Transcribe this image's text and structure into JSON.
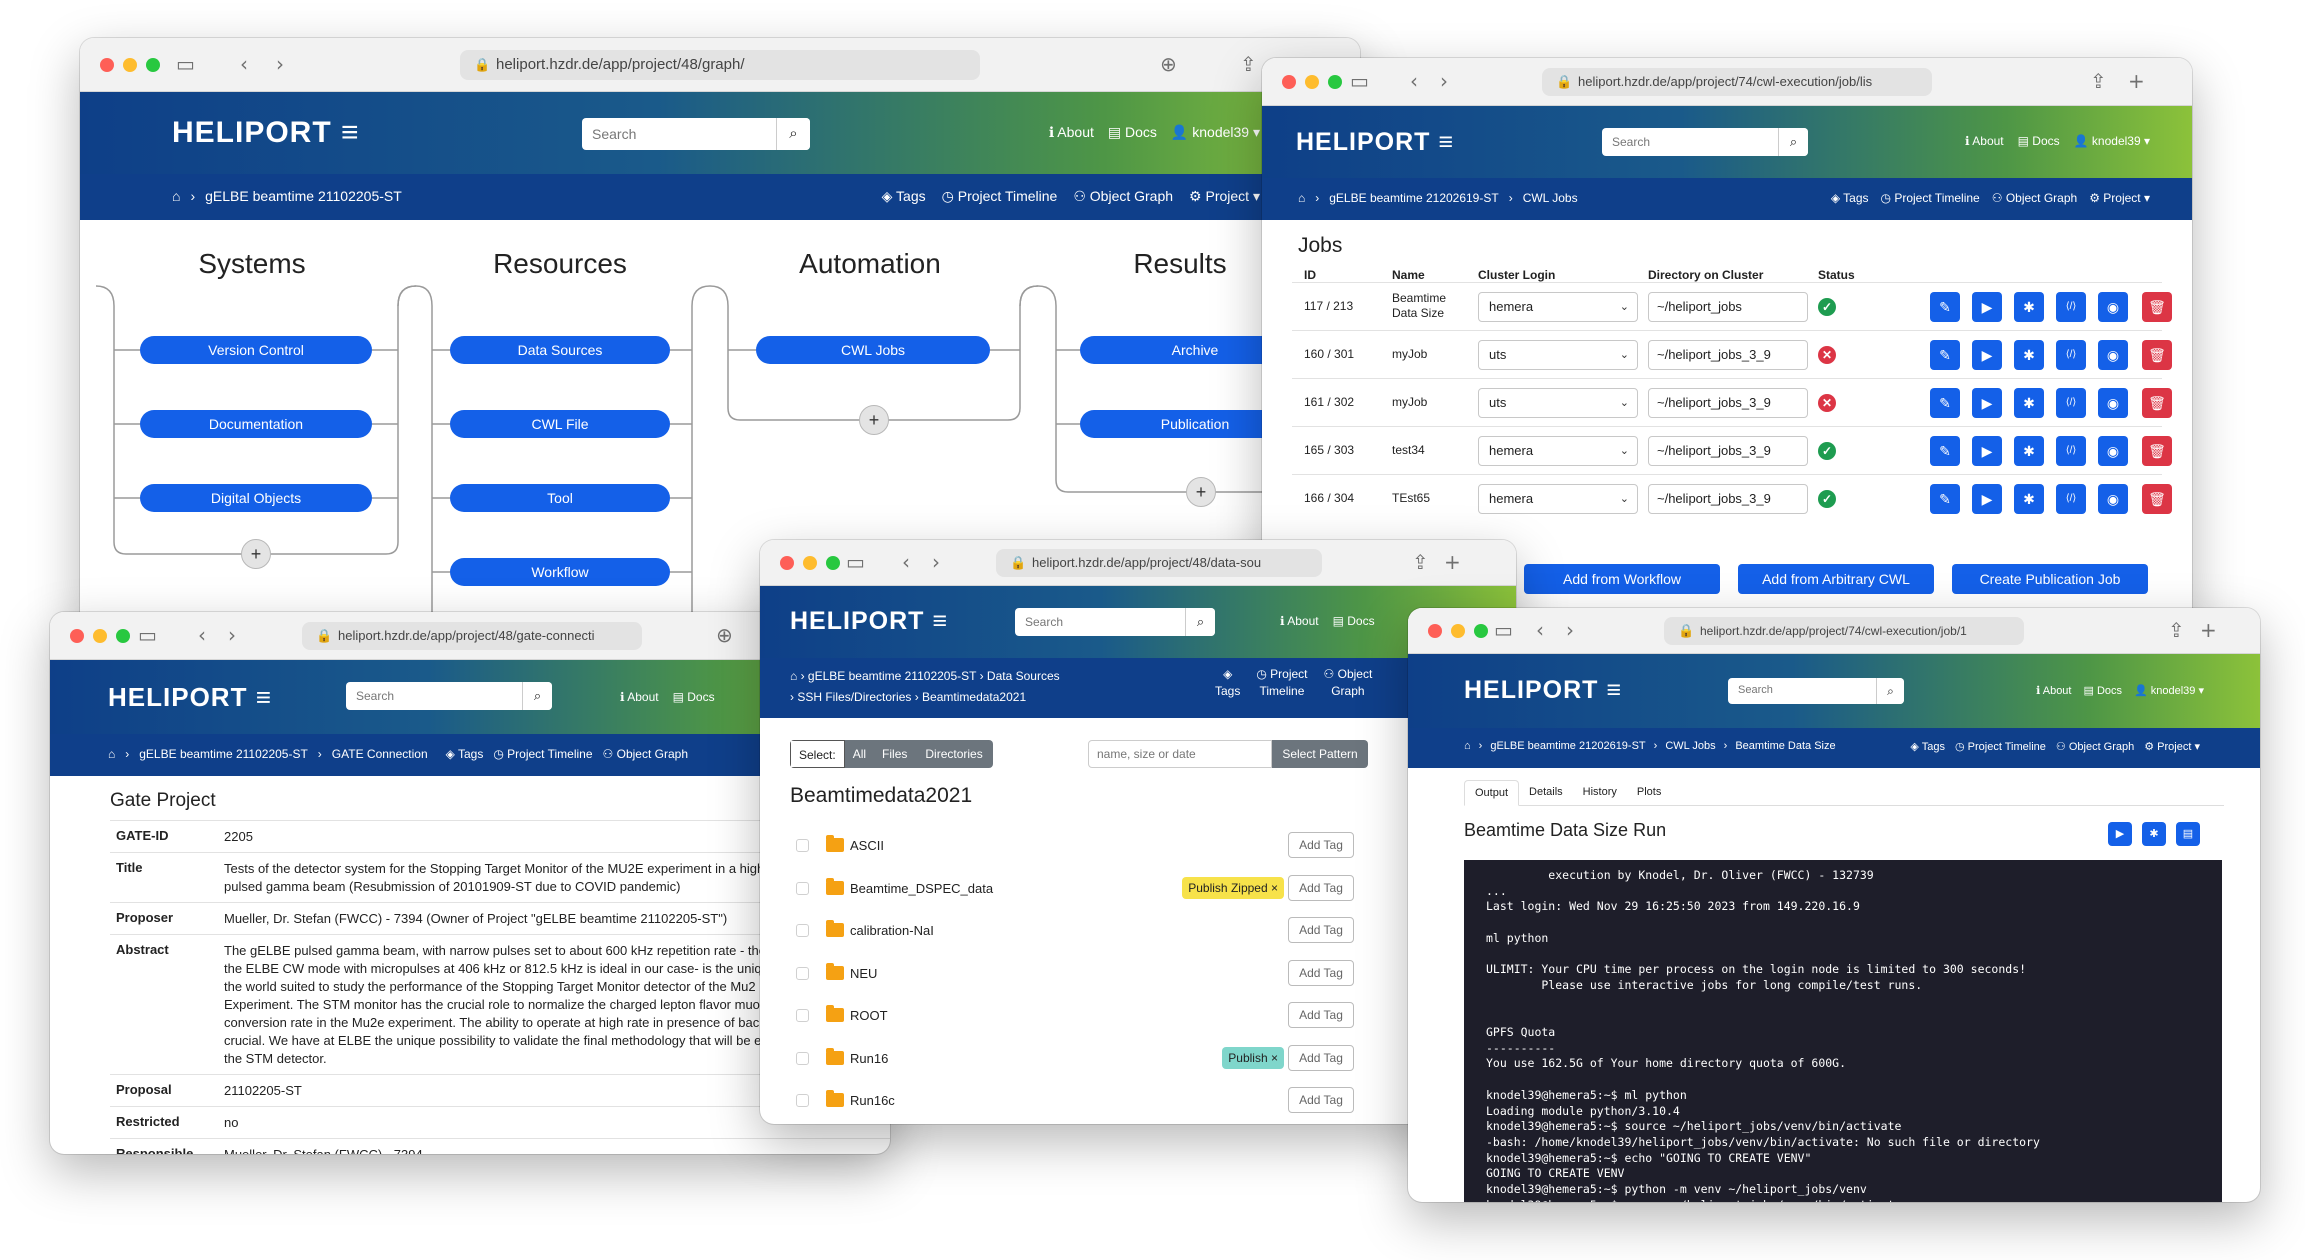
{
  "brand": {
    "logo_text": "HELIPORT"
  },
  "header": {
    "search_placeholder": "Search",
    "about": "About",
    "docs": "Docs",
    "user": "knodel39"
  },
  "graph_window": {
    "url": "heliport.hzdr.de/app/project/48/graph/",
    "breadcrumb": "gELBE beamtime 21102205-ST",
    "nav": [
      "Tags",
      "Project Timeline",
      "Object Graph",
      "Project"
    ],
    "columns": [
      {
        "title": "Systems",
        "items": [
          "Version Control",
          "Documentation",
          "Digital Objects"
        ]
      },
      {
        "title": "Resources",
        "items": [
          "Data Sources",
          "CWL File",
          "Tool",
          "Workflow"
        ]
      },
      {
        "title": "Automation",
        "items": [
          "CWL Jobs"
        ]
      },
      {
        "title": "Results",
        "items": [
          "Archive",
          "Publication"
        ]
      }
    ],
    "add_symbol": "+"
  },
  "jobs_window": {
    "url": "heliport.hzdr.de/app/project/74/cwl-execution/job/lis",
    "breadcrumb": [
      "gELBE beamtime 21202619-ST",
      "CWL Jobs"
    ],
    "nav": [
      "Tags",
      "Project Timeline",
      "Object Graph",
      "Project"
    ],
    "title": "Jobs",
    "columns": [
      "ID",
      "Name",
      "Cluster Login",
      "Directory on Cluster",
      "Status"
    ],
    "rows": [
      {
        "id": "117 / 213",
        "name": "Beamtime Data Size",
        "login": "hemera",
        "dir": "~/heliport_jobs",
        "status": "ok"
      },
      {
        "id": "160 / 301",
        "name": "myJob",
        "login": "uts",
        "dir": "~/heliport_jobs_3_9",
        "status": "failed"
      },
      {
        "id": "161 / 302",
        "name": "myJob",
        "login": "uts",
        "dir": "~/heliport_jobs_3_9",
        "status": "failed"
      },
      {
        "id": "165 / 303",
        "name": "test34",
        "login": "hemera",
        "dir": "~/heliport_jobs_3_9",
        "status": "ok"
      },
      {
        "id": "166 / 304",
        "name": "TEst65",
        "login": "hemera",
        "dir": "~/heliport_jobs_3_9",
        "status": "ok"
      }
    ],
    "buttons": [
      "Add from Workflow",
      "Add from Arbitrary CWL",
      "Create Publication Job"
    ]
  },
  "gate_window": {
    "url": "heliport.hzdr.de/app/project/48/gate-connecti",
    "breadcrumb": [
      "gELBE beamtime 21102205-ST",
      "GATE Connection"
    ],
    "nav": [
      "Tags",
      "Project Timeline",
      "Object Graph"
    ],
    "title": "Gate Project",
    "fields": [
      {
        "key": "GATE-ID",
        "value": "2205"
      },
      {
        "key": "Title",
        "value": "Tests of the detector system for the Stopping Target Monitor of the MU2E experiment in a high\npulsed gamma beam (Resubmission of 20101909-ST due to COVID pandemic)"
      },
      {
        "key": "Proposer",
        "value": "Mueller, Dr. Stefan (FWCC) - 7394 (Owner of Project \"gELBE beamtime 21102205-ST\")"
      },
      {
        "key": "Abstract",
        "value": "The gELBE pulsed gamma beam, with narrow pulses set to about 600 kHz repetition rate - the\nthe ELBE CW mode with micropulses at 406 kHz or 812.5 kHz is ideal in our case- is the uniqu\nthe world suited to study the performance of the Stopping Target Monitor detector of the Mu2\nExperiment. The STM monitor has the crucial role to normalize the charged lepton flavor muon\nconversion rate in the Mu2e experiment. The ability to operate at high rate in presence of back\ncrucial. We have at ELBE the unique possibility to validate the final methodology that will be en\nthe STM detector."
      },
      {
        "key": "Proposal",
        "value": "21102205-ST"
      },
      {
        "key": "Restricted",
        "value": "no"
      },
      {
        "key": "Responsible",
        "value": "Mueller, Dr. Stefan (FWCC) - 7394"
      }
    ]
  },
  "files_window": {
    "url": "heliport.hzdr.de/app/project/48/data-sou",
    "breadcrumb": [
      "gELBE beamtime 21102205-ST",
      "Data Sources",
      "SSH Files/Directories",
      "Beamtimedata2021"
    ],
    "nav": [
      "Tags",
      "Project Timeline",
      "Object Graph"
    ],
    "select_label": "Select:",
    "select_options": [
      "All",
      "Files",
      "Directories"
    ],
    "pattern_placeholder": "name, size or date",
    "pattern_button": "Select Pattern",
    "title": "Beamtimedata2021",
    "add_tag": "Add Tag",
    "items": [
      {
        "name": "ASCII",
        "badge": ""
      },
      {
        "name": "Beamtime_DSPEC_data",
        "badge": "Publish Zipped",
        "badge_color": "#f7e24a"
      },
      {
        "name": "calibration-NaI",
        "badge": ""
      },
      {
        "name": "NEU",
        "badge": ""
      },
      {
        "name": "ROOT",
        "badge": ""
      },
      {
        "name": "Run16",
        "badge": "Publish",
        "badge_color": "#7fd6cb"
      },
      {
        "name": "Run16c",
        "badge": ""
      }
    ]
  },
  "output_window": {
    "url": "heliport.hzdr.de/app/project/74/cwl-execution/job/1",
    "breadcrumb": [
      "gELBE beamtime 21202619-ST",
      "CWL Jobs",
      "Beamtime Data Size"
    ],
    "nav": [
      "Tags",
      "Project Timeline",
      "Object Graph",
      "Project"
    ],
    "tabs": [
      "Output",
      "Details",
      "History",
      "Plots"
    ],
    "title": "Beamtime Data Size Run",
    "terminal": "         execution by Knodel, Dr. Oliver (FWCC) - 132739\n...\nLast login: Wed Nov 29 16:25:50 2023 from 149.220.16.9\n\nml python\n\nULIMIT: Your CPU time per process on the login node is limited to 300 seconds!\n        Please use interactive jobs for long compile/test runs.\n\n\nGPFS Quota\n----------\nYou use 162.5G of Your home directory quota of 600G.\n\nknodel39@hemera5:~$ ml python\nLoading module python/3.10.4\nknodel39@hemera5:~$ source ~/heliport_jobs/venv/bin/activate\n-bash: /home/knodel39/heliport_jobs/venv/bin/activate: No such file or directory\nknodel39@hemera5:~$ echo \"GOING TO CREATE VENV\"\nGOING TO CREATE VENV\nknodel39@hemera5:~$ python -m venv ~/heliport_jobs/venv\nknodel39@hemera5:~$ source ~/heliport_jobs/venv/bin/activate\n(venv) knodel39@hemera5:~$ pip list | grep cwltool"
  }
}
